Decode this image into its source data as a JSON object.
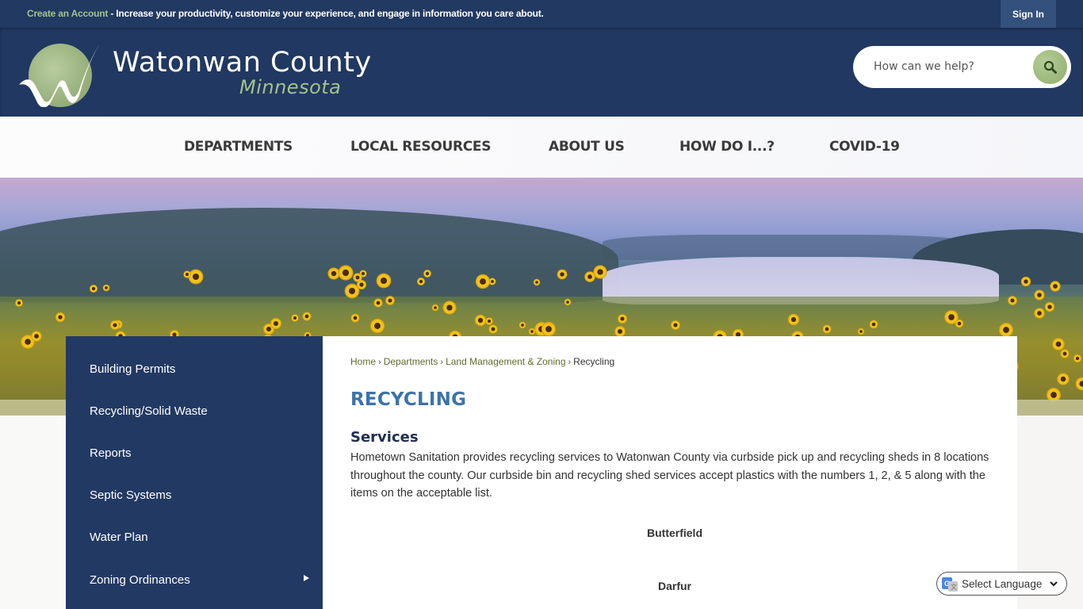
{
  "topbar": {
    "create_account_link": "Create an Account",
    "promo_text": " - Increase your productivity, customize your experience, and engage in information you care about.",
    "sign_in_label": "Sign In"
  },
  "header": {
    "brand_title": "Watonwan County",
    "brand_subtitle": "Minnesota",
    "search_placeholder": "How can we help?",
    "search_value": "",
    "search_icon": "search-icon"
  },
  "nav": {
    "items": [
      {
        "label": "DEPARTMENTS"
      },
      {
        "label": "LOCAL RESOURCES"
      },
      {
        "label": "ABOUT US"
      },
      {
        "label": "HOW DO I...?"
      },
      {
        "label": "COVID-19"
      }
    ]
  },
  "sidebar": {
    "items": [
      {
        "label": "Building Permits"
      },
      {
        "label": "Recycling/Solid Waste"
      },
      {
        "label": "Reports"
      },
      {
        "label": "Septic Systems"
      },
      {
        "label": "Water Plan"
      },
      {
        "label": "Zoning Ordinances",
        "has_submenu": true
      }
    ]
  },
  "breadcrumb": {
    "items": [
      {
        "label": "Home"
      },
      {
        "label": "Departments"
      },
      {
        "label": "Land Management & Zoning"
      },
      {
        "label": "Recycling"
      }
    ],
    "separator": "›"
  },
  "content": {
    "page_title": "RECYCLING",
    "section_title": "Services",
    "body": "Hometown Sanitation provides recycling services to Watonwan County via curbside pick up and recycling sheds in 8 locations throughout the county. Our curbside bin and recycling shed services accept plastics with the numbers 1, 2, & 5 along with the items on the acceptable list.",
    "locations": [
      "Butterfield",
      "Darfur"
    ]
  },
  "language": {
    "label": "Select Language"
  },
  "colors": {
    "navy": "#223962",
    "accent_green": "#a3c48a",
    "title_blue": "#3e73a7",
    "breadcrumb_green": "#5e6b2b"
  }
}
